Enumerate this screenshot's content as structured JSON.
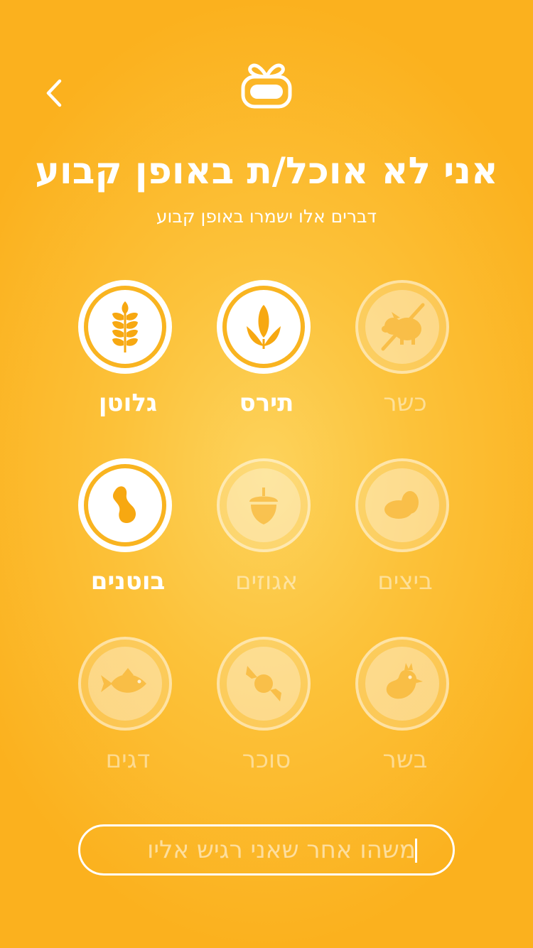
{
  "header": {
    "back_icon": "chevron-left-icon",
    "logo_icon": "gift-box-logo"
  },
  "page": {
    "title": "אני לא אוכל/ת באופן קבוע",
    "subtitle": "דברים אלו ישמרו באופן קבוע"
  },
  "options": [
    {
      "label": "גלוטן",
      "icon": "wheat-icon",
      "selected": true
    },
    {
      "label": "תירס",
      "icon": "corn-icon",
      "selected": true
    },
    {
      "label": "כשר",
      "icon": "no-pig-icon",
      "selected": false
    },
    {
      "label": "בוטנים",
      "icon": "peanut-icon",
      "selected": true
    },
    {
      "label": "אגוזים",
      "icon": "acorn-icon",
      "selected": false
    },
    {
      "label": "ביצים",
      "icon": "eggs-icon",
      "selected": false
    },
    {
      "label": "דגים",
      "icon": "fish-icon",
      "selected": false
    },
    {
      "label": "סוכר",
      "icon": "candy-icon",
      "selected": false
    },
    {
      "label": "בשר",
      "icon": "chicken-icon",
      "selected": false
    }
  ],
  "other_input": {
    "placeholder": "משהו אחר שאני רגיש אליו"
  },
  "colors": {
    "background": "#fbb11e",
    "icon": "#f7a811",
    "text": "#ffffff"
  }
}
